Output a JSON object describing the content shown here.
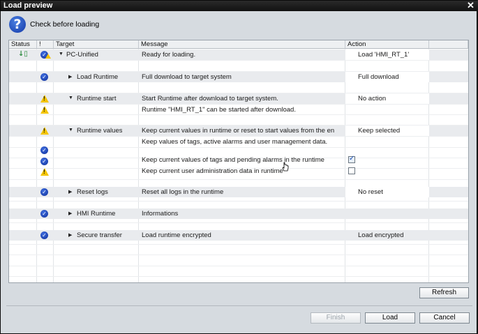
{
  "window": {
    "title": "Load preview",
    "close_glyph": "✕"
  },
  "header": {
    "text": "Check before loading",
    "icon": "question-icon"
  },
  "columns": [
    "Status",
    "!",
    "Target",
    "Message",
    "Action"
  ],
  "rows": [
    {
      "icon": "check-warning",
      "expand": "down",
      "target": "PC-Unified",
      "message": "Ready for loading.",
      "action": "Load 'HMI_RT_1'",
      "status": "load-arrow-icon"
    },
    {
      "icon": "check",
      "expand": "right",
      "target": "Load Runtime",
      "message": "Full download to target system",
      "action": "Full download"
    },
    {
      "icon": "warning",
      "expand": "down",
      "target": "Runtime start",
      "message": "Start Runtime after download to target system.",
      "action": "No action"
    },
    {
      "icon": "warning",
      "message": "Runtime \"HMI_RT_1\" can be started after download."
    },
    {
      "icon": "warning",
      "expand": "down",
      "target": "Runtime values",
      "message": "Keep current values in runtime or reset to start values from the en",
      "action": "Keep selected"
    },
    {
      "icon": "check",
      "message": "Keep values of tags, active alarms and user management data."
    },
    {
      "icon": "check",
      "message": "Keep current values of tags and pending alarms in the runtime",
      "checkbox": true
    },
    {
      "icon": "warning",
      "message": "Keep current user administration data in runtime",
      "checkbox": false
    },
    {
      "icon": "check",
      "expand": "right",
      "target": "Reset logs",
      "message": "Reset all logs in the runtime",
      "action": "No reset"
    },
    {
      "icon": "check",
      "expand": "right",
      "target": "HMI Runtime",
      "message": "Informations"
    },
    {
      "icon": "check",
      "expand": "right",
      "target": "Secure transfer",
      "message": "Load runtime encrypted",
      "action": "Load encrypted"
    }
  ],
  "buttons": {
    "refresh": "Refresh",
    "finish": "Finish",
    "load": "Load",
    "cancel": "Cancel"
  },
  "colors": {
    "title_bg": "#1a1a1a",
    "dialog_bg": "#d6dbe0",
    "warning": "#f3c400",
    "check": "#1d3fae"
  }
}
